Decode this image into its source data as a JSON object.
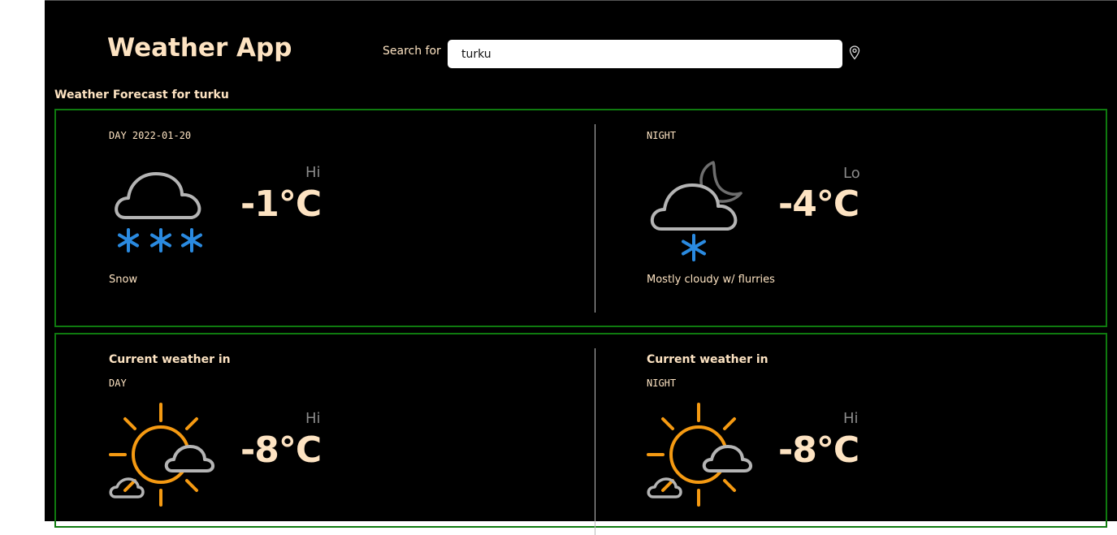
{
  "header": {
    "title": "Weather App",
    "search_label": "Search for",
    "search_value": "turku",
    "location_icon": "map-pin-icon"
  },
  "forecast": {
    "heading": "Weather Forecast for turku",
    "day": {
      "period_label": "DAY 2022-01-20",
      "hilo_label": "Hi",
      "temperature": "-1°C",
      "description": "Snow",
      "icon": "snow-icon"
    },
    "night": {
      "period_label": "NIGHT",
      "hilo_label": "Lo",
      "temperature": "-4°C",
      "description": "Mostly cloudy w/ flurries",
      "icon": "night-cloudy-flurries-icon"
    }
  },
  "current": {
    "day": {
      "title": "Current weather in",
      "period_label": "DAY",
      "hilo_label": "Hi",
      "temperature": "-8°C",
      "icon": "partly-sunny-icon"
    },
    "night": {
      "title": "Current weather in",
      "period_label": "NIGHT",
      "hilo_label": "Hi",
      "temperature": "-8°C",
      "icon": "partly-sunny-icon"
    }
  },
  "colors": {
    "background": "#000000",
    "text": "#fde3c2",
    "card_border": "#0f7a0f",
    "snow": "#2a8ae0",
    "sun": "#f59a12",
    "cloud": "#b4b4b4"
  }
}
